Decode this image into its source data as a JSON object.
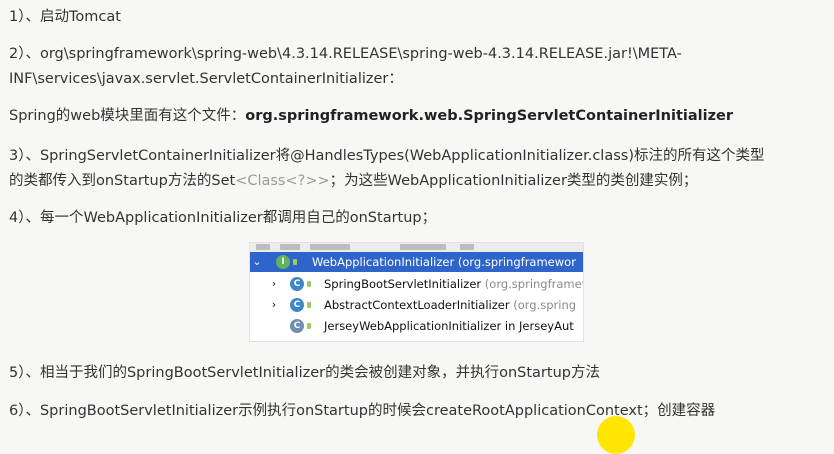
{
  "lines": {
    "l1": "1）、启动Tomcat",
    "l2a": "2）、org\\springframework\\spring-web\\4.3.14.RELEASE\\spring-web-4.3.14.RELEASE.jar!\\META-",
    "l2b": "INF\\services\\javax.servlet.ServletContainerInitializer：",
    "l3_prefix": "Spring的web模块里面有这个文件：",
    "l3_bold": "org.springframework.web.SpringServletContainerInitializer",
    "l4a": "3）、SpringServletContainerInitializer将@HandlesTypes(WebApplicationInitializer.class)标注的所有这个类型",
    "l4b_prefix": "的类都传入到onStartup方法的Set",
    "l4b_grey": "<Class<?>>",
    "l4b_suffix": "；为这些WebApplicationInitializer类型的类创建实例；",
    "l5": "4）、每一个WebApplicationInitializer都调用自己的onStartup；",
    "l6": "5）、相当于我们的SpringBootServletInitializer的类会被创建对象，并执行onStartup方法",
    "l7": "6）、SpringBootServletInitializer示例执行onStartup的时候会createRootApplicationContext；创建容器"
  },
  "hierarchy": {
    "rows": [
      {
        "name": "WebApplicationInitializer",
        "pkg": "(org.springframewor",
        "icon": "I",
        "selected": true,
        "chevron": "down-icon"
      },
      {
        "name": "SpringBootServletInitializer",
        "pkg": "(org.springframew",
        "icon": "C",
        "selected": false,
        "chevron": "right-icon"
      },
      {
        "name": "AbstractContextLoaderInitializer",
        "pkg": "(org.spring",
        "icon": "C",
        "selected": false,
        "chevron": "right-icon"
      },
      {
        "name": "JerseyWebApplicationInitializer in JerseyAut",
        "pkg": "",
        "icon": "C",
        "selected": false,
        "chevron": ""
      }
    ]
  },
  "colors": {
    "selection": "#2f65ca",
    "interface_icon": "#5fb35f",
    "class_icon": "#3f87c8",
    "highlight_dot": "#ffe600"
  }
}
